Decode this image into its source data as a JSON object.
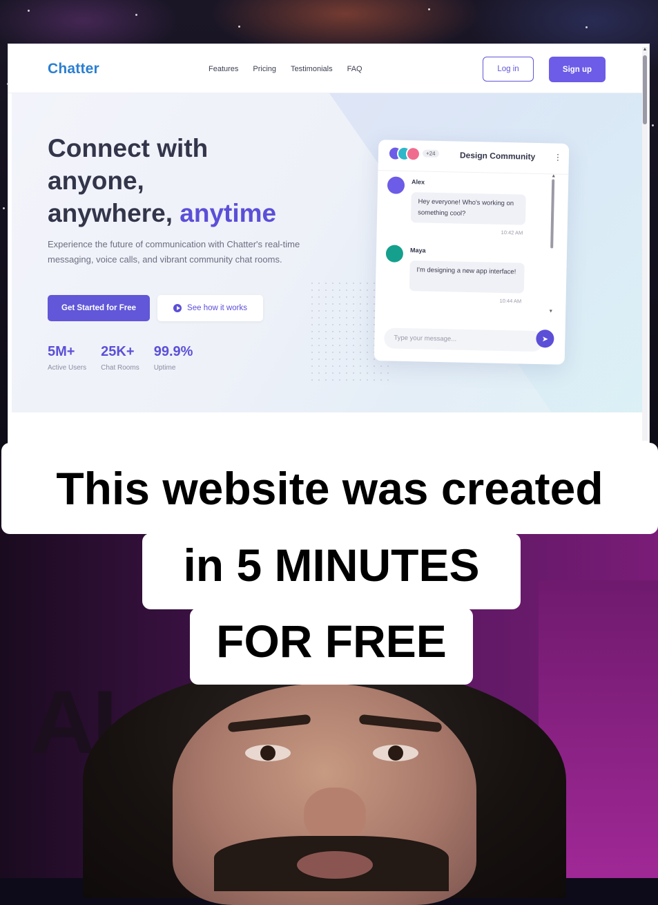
{
  "site": {
    "logo": "Chatter",
    "nav_links": [
      "Features",
      "Pricing",
      "Testimonials",
      "FAQ"
    ],
    "login_label": "Log in",
    "signup_label": "Sign up"
  },
  "hero": {
    "headline_line1": "Connect with",
    "headline_line2": "anyone,",
    "headline_line3_plain": "anywhere, ",
    "headline_line3_accent": "anytime",
    "subtext": "Experience the future of communication with Chatter's real-time messaging, voice calls, and vibrant community chat rooms.",
    "cta_primary": "Get Started for Free",
    "cta_secondary": "See how it works",
    "stats": [
      {
        "value": "5M+",
        "label": "Active Users"
      },
      {
        "value": "25K+",
        "label": "Chat Rooms"
      },
      {
        "value": "99.9%",
        "label": "Uptime"
      }
    ]
  },
  "chat": {
    "member_more": "+24",
    "title": "Design Community",
    "messages": [
      {
        "name": "Alex",
        "text": "Hey everyone! Who's working on something cool?",
        "time": "10:42 AM",
        "color": "#6c5ce7"
      },
      {
        "name": "Maya",
        "text": "I'm designing a new app interface!",
        "time": "10:44 AM",
        "color": "#14a08c"
      }
    ],
    "input_placeholder": "Type your message...",
    "avatar_colors": [
      "#6c5ce7",
      "#2fb6c9",
      "#f06c8f"
    ]
  },
  "caption": {
    "line1": "This website was created",
    "line2": "in 5 MINUTES",
    "line3": "FOR FREE"
  },
  "background_text": "AI",
  "colors": {
    "brand_blue": "#2a7fd0",
    "accent_purple": "#5b4fd8",
    "caption_bg": "#ffffff"
  }
}
